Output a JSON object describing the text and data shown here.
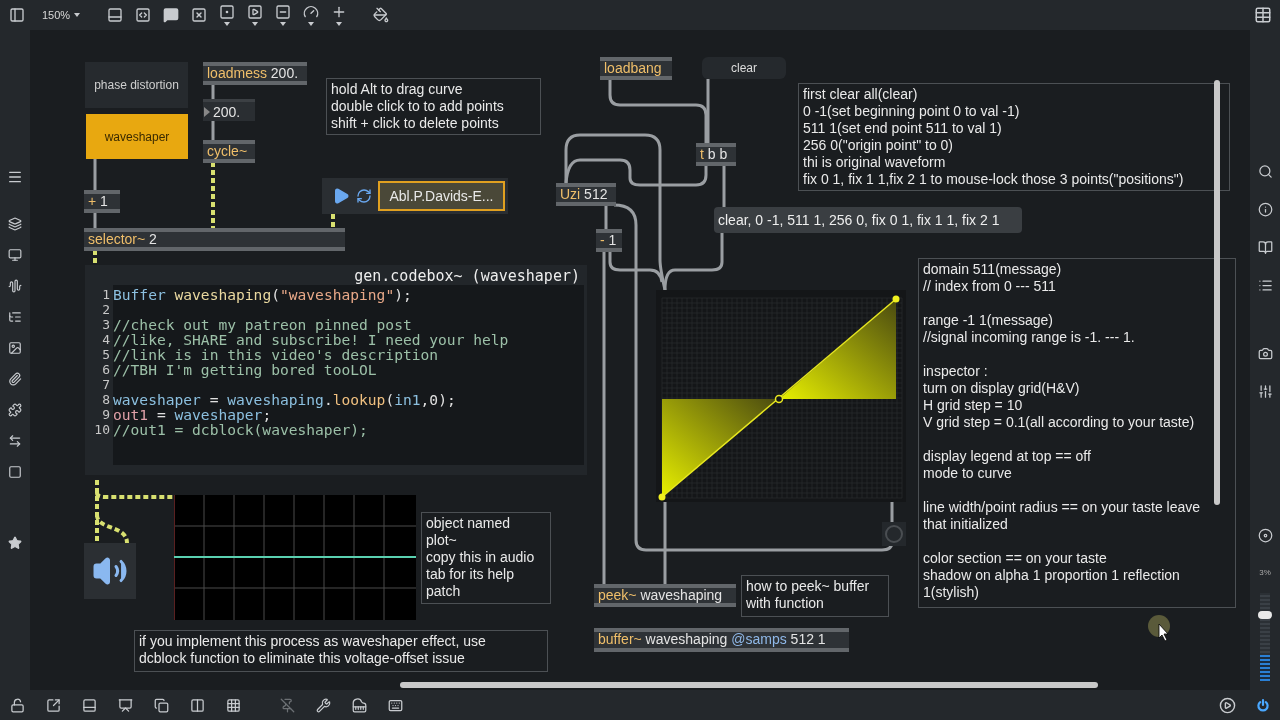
{
  "toolbar": {
    "zoom": "150%"
  },
  "patch": [
    {
      "kind": "textbutton",
      "text": "phase distortion",
      "on": false
    },
    {
      "kind": "textbutton",
      "text": "waveshaper",
      "on": true
    },
    {
      "kind": "object",
      "name": "loadmess",
      "args": "200."
    },
    {
      "kind": "number",
      "value": "200."
    },
    {
      "kind": "object",
      "name": "cycle~"
    },
    {
      "kind": "comment",
      "paragraphs": [
        [
          "hold Alt to drag curve",
          "double click to to add points",
          "shift + click to delete points"
        ]
      ]
    },
    {
      "kind": "object",
      "name": "loadbang"
    },
    {
      "kind": "button",
      "text": "clear"
    },
    {
      "kind": "object",
      "name": "t",
      "args": "b b"
    },
    {
      "kind": "player",
      "file": "Abl.P.Davids-E..."
    },
    {
      "kind": "object",
      "name": "Uzi",
      "args": "512"
    },
    {
      "kind": "comment",
      "paragraphs": [
        [
          "first clear all(clear)",
          "0 -1(set beginning point 0 to val -1)",
          "511 1(set end point 511 to val 1)",
          "256 0(\"origin point\" to 0)",
          "thi is original waveform",
          "fix 0 1, fix 1 1,fix 2 1 to mouse-lock those 3 points(\"positions\")"
        ]
      ]
    },
    {
      "kind": "object",
      "name": "+",
      "args": "1"
    },
    {
      "kind": "object",
      "name": "selector~",
      "args": "2"
    },
    {
      "kind": "object",
      "name": "-",
      "args": "1"
    },
    {
      "kind": "message",
      "text": "clear, 0 -1, 511 1, 256 0, fix 0 1, fix 1 1, fix 2 1"
    },
    {
      "kind": "codebox",
      "title": "gen.codebox~ (waveshaper)",
      "lines": [
        {
          "number": "1",
          "tokens": [
            {
              "kind": "type",
              "text": "Buffer "
            },
            {
              "kind": "name",
              "text": "waveshaping"
            },
            {
              "kind": "plain",
              "text": "("
            },
            {
              "kind": "string",
              "text": "\"waveshaping\""
            },
            {
              "kind": "plain",
              "text": ");"
            }
          ]
        },
        {
          "number": "2"
        },
        {
          "number": "3",
          "tokens": [
            {
              "kind": "comment",
              "text": "//check out my patreon pinned post"
            }
          ]
        },
        {
          "number": "4",
          "tokens": [
            {
              "kind": "comment",
              "text": "//like, SHARE and subscribe! I need your help"
            }
          ]
        },
        {
          "number": "5",
          "tokens": [
            {
              "kind": "comment",
              "text": "//link is in this video's description"
            }
          ]
        },
        {
          "number": "6",
          "tokens": [
            {
              "kind": "comment",
              "text": "//TBH I'm getting bored tooLOL"
            }
          ]
        },
        {
          "number": "7"
        },
        {
          "number": "8",
          "tokens": [
            {
              "kind": "ident",
              "text": "waveshaper"
            },
            {
              "kind": "plain",
              "text": " = "
            },
            {
              "kind": "ident",
              "text": "waveshaping"
            },
            {
              "kind": "plain",
              "text": "."
            },
            {
              "kind": "func",
              "text": "lookup"
            },
            {
              "kind": "plain",
              "text": "("
            },
            {
              "kind": "ident",
              "text": "in1"
            },
            {
              "kind": "plain",
              "text": ",0);"
            }
          ]
        },
        {
          "number": "9",
          "tokens": [
            {
              "kind": "output",
              "text": "out1"
            },
            {
              "kind": "plain",
              "text": " = "
            },
            {
              "kind": "ident",
              "text": "waveshaper"
            },
            {
              "kind": "plain",
              "text": ";"
            }
          ]
        },
        {
          "number": "10",
          "tokens": [
            {
              "kind": "comment",
              "text": "//out1 = dcblock(waveshaper);"
            }
          ]
        }
      ]
    },
    {
      "kind": "function"
    },
    {
      "kind": "speaker"
    },
    {
      "kind": "plot"
    },
    {
      "kind": "comment",
      "paragraphs": [
        [
          "object named",
          "plot~",
          "copy this in audio",
          "tab for its help",
          "patch"
        ]
      ]
    },
    {
      "kind": "toggle"
    },
    {
      "kind": "object",
      "name": "peek~",
      "args": "waveshaping"
    },
    {
      "kind": "comment",
      "paragraphs": [
        [
          "how to peek~ buffer",
          "with function"
        ]
      ]
    },
    {
      "kind": "comment",
      "paragraphs": [
        [
          "domain 511(message)",
          "// index from 0 --- 511"
        ],
        [
          "range -1 1(message)",
          "//signal incoming range is -1. --- 1."
        ],
        [
          "inspector :",
          "turn on display grid(H&V)",
          "H grid step = 10",
          "V grid step = 0.1(all according to your taste)"
        ],
        [
          "display legend at top == off",
          "mode to curve"
        ],
        [
          "line width/point radius == on your taste leave",
          "that initialized"
        ],
        [
          "color section == on your taste",
          "shadow on alpha 1 proportion 1 reflection",
          "1(stylish)"
        ]
      ]
    },
    {
      "kind": "comment",
      "paragraphs": [
        [
          "if you implement this process as waveshaper effect, use",
          "dcblock function to eliminate this voltage-offset issue"
        ]
      ]
    },
    {
      "kind": "object",
      "name": "buffer~",
      "args": "waveshaping",
      "attribute": "@samps",
      "attribute_value": "512 1"
    }
  ],
  "meter": {
    "cpu": "3%",
    "level": 0.75
  }
}
